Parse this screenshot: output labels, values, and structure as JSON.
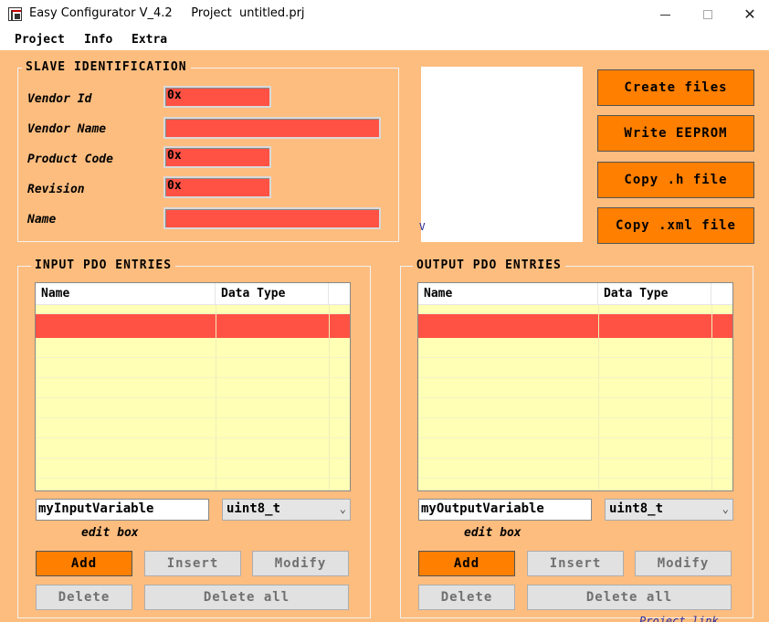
{
  "window": {
    "title": "Easy Configurator V_4.2     Project  untitled.prj",
    "close_glyph": "✕"
  },
  "menu": {
    "items": [
      {
        "label": "Project"
      },
      {
        "label": "Info"
      },
      {
        "label": "Extra"
      }
    ]
  },
  "slave": {
    "title": "SLAVE IDENTIFICATION",
    "fields": [
      {
        "label": "Vendor Id",
        "value": "0x"
      },
      {
        "label": "Vendor Name",
        "value": ""
      },
      {
        "label": "Product Code",
        "value": "0x"
      },
      {
        "label": "Revision",
        "value": "0x"
      },
      {
        "label": "Name",
        "value": ""
      }
    ]
  },
  "actions": {
    "create_files": "Create files",
    "write_eeprom": "Write EEPROM",
    "copy_h": "Copy .h file",
    "copy_xml": "Copy .xml file"
  },
  "preview": {
    "mark": "V"
  },
  "input_pdo": {
    "title": "INPUT PDO ENTRIES",
    "columns": [
      "Name",
      "Data Type"
    ],
    "edit_value": "myInputVariable",
    "type_value": "uint8_t",
    "edit_caption": "edit box",
    "buttons": {
      "add": "Add",
      "insert": "Insert",
      "modify": "Modify",
      "delete": "Delete",
      "delete_all": "Delete all"
    }
  },
  "output_pdo": {
    "title": "OUTPUT PDO ENTRIES",
    "columns": [
      "Name",
      "Data Type"
    ],
    "edit_value": "myOutputVariable",
    "type_value": "uint8_t",
    "edit_caption": "edit box",
    "buttons": {
      "add": "Add",
      "insert": "Insert",
      "modify": "Modify",
      "delete": "Delete",
      "delete_all": "Delete all"
    }
  },
  "footer": {
    "link": "Project link"
  },
  "colors": {
    "background": "#fdbd7f",
    "field_red": "#ff5245",
    "button_orange": "#ff7f00",
    "list_yellow": "#ffffb5"
  }
}
